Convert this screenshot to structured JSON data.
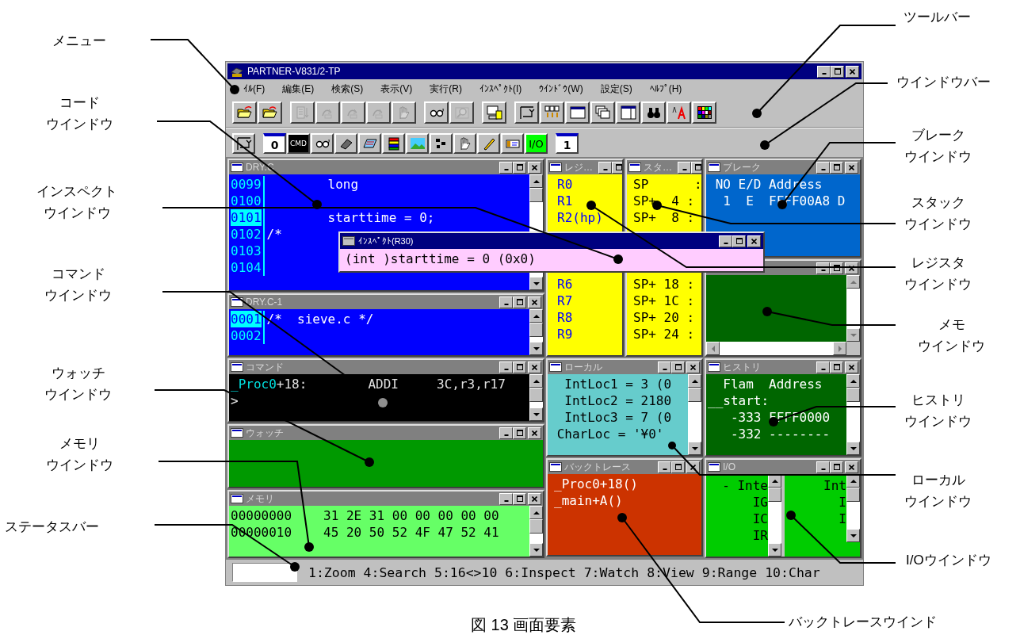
{
  "left_callouts": [
    {
      "lines": [
        "メニュー"
      ]
    },
    {
      "lines": [
        "コード",
        "ウインドウ"
      ]
    },
    {
      "lines": [
        "インスペクト",
        "ウインドウ"
      ]
    },
    {
      "lines": [
        "コマンド",
        "ウインドウ"
      ]
    },
    {
      "lines": [
        "ウォッチ",
        "ウインドウ"
      ]
    },
    {
      "lines": [
        "メモリ",
        "ウインドウ"
      ]
    },
    {
      "lines": [
        "ステータスバー"
      ]
    }
  ],
  "right_callouts": [
    {
      "lines": [
        "ツールバー"
      ]
    },
    {
      "lines": [
        "ウインドウバー"
      ]
    },
    {
      "lines": [
        "ブレーク",
        "ウインドウ"
      ]
    },
    {
      "lines": [
        "スタック",
        "ウインドウ"
      ]
    },
    {
      "lines": [
        "レジスタ",
        "ウインドウ"
      ]
    },
    {
      "lines": [
        "メモ",
        "ウインドウ"
      ]
    },
    {
      "lines": [
        "ヒストリ",
        "ウインドウ"
      ]
    },
    {
      "lines": [
        "ローカル",
        "ウインドウ"
      ]
    },
    {
      "lines": [
        "I/Oウインドウ"
      ]
    },
    {
      "lines": [
        "バックトレースウインド"
      ]
    }
  ],
  "window": {
    "title": "PARTNER-V831/2-TP"
  },
  "menu": [
    "ｲﾙ(F)",
    "編集(E)",
    "検索(S)",
    "表示(V)",
    "実行(R)",
    "ｲﾝｽﾍﾟｸﾄ(I)",
    "ｳｲﾝﾄﾞｳ(W)",
    "設定(S)",
    "ﾍﾙﾌﾟ(H)"
  ],
  "toolbar": {
    "groups": [
      {
        "buttons": [
          {
            "kind": "folder",
            "disabled": false
          },
          {
            "kind": "folder-reload",
            "disabled": false
          }
        ]
      },
      {
        "buttons": [
          {
            "kind": "page",
            "disabled": true
          },
          {
            "kind": "step",
            "disabled": true
          },
          {
            "kind": "step",
            "disabled": true
          },
          {
            "kind": "step",
            "disabled": true
          },
          {
            "kind": "hand",
            "disabled": true
          }
        ]
      },
      {
        "buttons": [
          {
            "kind": "glasses",
            "disabled": false
          },
          {
            "kind": "magnifier",
            "disabled": true
          }
        ]
      },
      {
        "buttons": [
          {
            "kind": "monitor",
            "disabled": false
          }
        ]
      },
      {
        "buttons": [
          {
            "kind": "layout",
            "disabled": false
          },
          {
            "kind": "tile",
            "disabled": false
          },
          {
            "kind": "window",
            "disabled": false
          },
          {
            "kind": "cascade",
            "disabled": false
          },
          {
            "kind": "split",
            "disabled": false
          },
          {
            "kind": "binoculars",
            "disabled": false
          },
          {
            "kind": "font",
            "disabled": false
          },
          {
            "kind": "palette",
            "disabled": false
          }
        ]
      }
    ]
  },
  "window_bar": {
    "groups": [
      {
        "buttons": [
          {
            "kind": "layout"
          }
        ]
      },
      {
        "buttons": [
          {
            "kind": "text",
            "label": "0"
          },
          {
            "kind": "cmd",
            "label": "CMD"
          },
          {
            "kind": "glasses"
          },
          {
            "kind": "eraser"
          },
          {
            "kind": "chip"
          },
          {
            "kind": "books"
          },
          {
            "kind": "landscape"
          },
          {
            "kind": "cells"
          },
          {
            "kind": "hand"
          },
          {
            "kind": "pencil"
          },
          {
            "kind": "card"
          },
          {
            "kind": "io",
            "label": "I/O"
          }
        ]
      },
      {
        "buttons": [
          {
            "kind": "text",
            "label": "1"
          }
        ]
      }
    ]
  },
  "columns": [
    {
      "rows": [
        [
          {
            "kind": "code",
            "title": "DRY.C",
            "code": [
              {
                "no": "0099",
                "text": "        long",
                "selected": false
              },
              {
                "no": "0100",
                "selected": false
              },
              {
                "no": "0101",
                "text": "        starttime = 0;",
                "selected": true
              },
              {
                "no": "0102",
                "text": "/*",
                "selected": false
              },
              {
                "no": "0103",
                "selected": false
              },
              {
                "no": "0104",
                "selected": false
              }
            ]
          }
        ],
        [
          {
            "kind": "code",
            "title": "DRY.C-1",
            "code": [
              {
                "no": "0001",
                "text": "/*  sieve.c */",
                "selected": true
              },
              {
                "no": "0002",
                "selected": false
              }
            ]
          }
        ],
        [
          {
            "kind": "command",
            "title": "コマンド",
            "command": {
              "symbol": "_Proc0",
              "text": "+18:        ADDI     3C,r3,r17",
              "prompt": ">"
            }
          }
        ],
        [
          {
            "kind": "watch",
            "title": "ウォッチ"
          }
        ],
        [
          {
            "kind": "memory",
            "title": "メモリ",
            "memory": [
              {
                "address": "00000000",
                "bytes": "31 2E 31 00 00 00 00 00"
              },
              {
                "address": "00000010",
                "bytes": "45 20 50 52 4F 47 52 41"
              }
            ]
          }
        ]
      ]
    },
    {
      "rows": [
        [
          {
            "kind": "register",
            "title": "レジ…",
            "lines": [
              "R0",
              "R1",
              "R2(hp)"
            ],
            "lines_below": [
              "R6",
              "R7",
              "R8",
              "R9"
            ]
          },
          {
            "kind": "stack",
            "title": "スタ…",
            "lines": [
              "SP      :",
              "SP+  4 :",
              "SP+  8 :"
            ],
            "lines_below": [
              "SP+ 18 :",
              "SP+ 1C :",
              "SP+ 20 :",
              "SP+ 24 :"
            ]
          }
        ],
        [
          {
            "kind": "local",
            "title": "ローカル",
            "lines": [
              "  IntLoc1 = 3 (0",
              "  IntLoc2 = 2180",
              "  IntLoc3 = 7 (0",
              " CharLoc = '¥0'"
            ]
          }
        ],
        [
          {
            "kind": "backtrace",
            "title": "バックトレース",
            "lines": [
              "_Proc0+18()",
              "_main+A()"
            ]
          }
        ]
      ]
    },
    {
      "rows": [
        [
          {
            "kind": "break",
            "title": "ブレーク",
            "lines": [
              " NO E/D Address",
              "  1  E  FFFF00A8 D"
            ]
          }
        ],
        [
          {
            "kind": "memo"
          }
        ],
        [
          {
            "kind": "history",
            "title": "ヒストリ",
            "lines": [
              "  Flam  Address",
              "__start:",
              "   -333 FFFF0000",
              "   -332 --------"
            ]
          }
        ],
        [
          {
            "kind": "io",
            "title": "I/O",
            "io_left": [
              "- Inte",
              "IG",
              "IC",
              "IR"
            ],
            "io_right": [
              "Int",
              "I",
              "I"
            ]
          }
        ]
      ]
    }
  ],
  "inspect": {
    "title": "ｲﾝｽﾍﾟｸﾄ(R30)",
    "text": "(int )starttime = 0 (0x0)"
  },
  "status_bar": {
    "text": "1:Zoom 4:Search 5:16<>10 6:Inspect 7:Watch 8:View 9:Range 10:Char"
  },
  "caption": "図 13 画面要素"
}
